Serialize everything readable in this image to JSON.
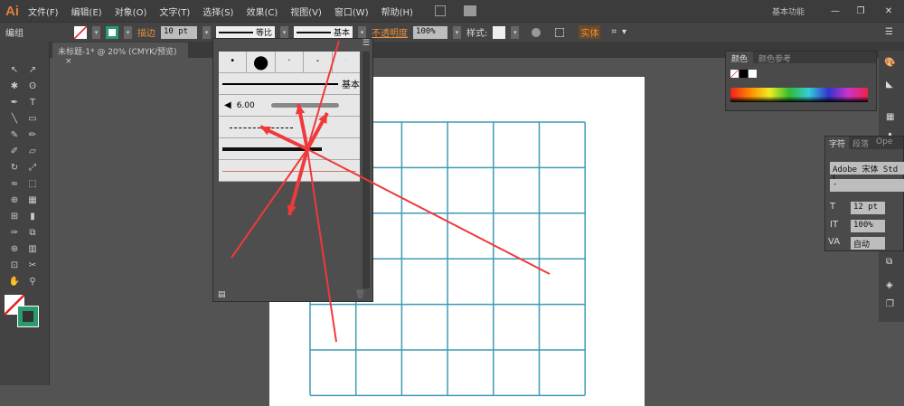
{
  "app": {
    "logo": "Ai",
    "workspace": "基本功能"
  },
  "menu": [
    "文件(F)",
    "编辑(E)",
    "对象(O)",
    "文字(T)",
    "选择(S)",
    "效果(C)",
    "视图(V)",
    "窗口(W)",
    "帮助(H)"
  ],
  "control": {
    "selection": "编组",
    "stroke_label": "描边",
    "stroke_weight": "10 pt",
    "profile": "等比",
    "brush": "基本",
    "opacity_label": "不透明度",
    "opacity": "100%",
    "style_label": "样式:",
    "recolor": "实体"
  },
  "document": {
    "tab": "未标题-1* @ 20% (CMYK/预览)"
  },
  "brushes": {
    "basic": "基本",
    "pressure": "6.00"
  },
  "color_panel": {
    "tabs": [
      "颜色",
      "颜色参考"
    ]
  },
  "char_panel": {
    "tabs": [
      "字符",
      "段落",
      "Ope"
    ],
    "font": "Adobe 宋体 Std L",
    "style": "-",
    "size": "12 pt",
    "scale": "100%",
    "tracking": "自动"
  },
  "colors": {
    "grid": "#3d9bb3",
    "arrow": "#f0393b",
    "accent": "#e8913b"
  }
}
